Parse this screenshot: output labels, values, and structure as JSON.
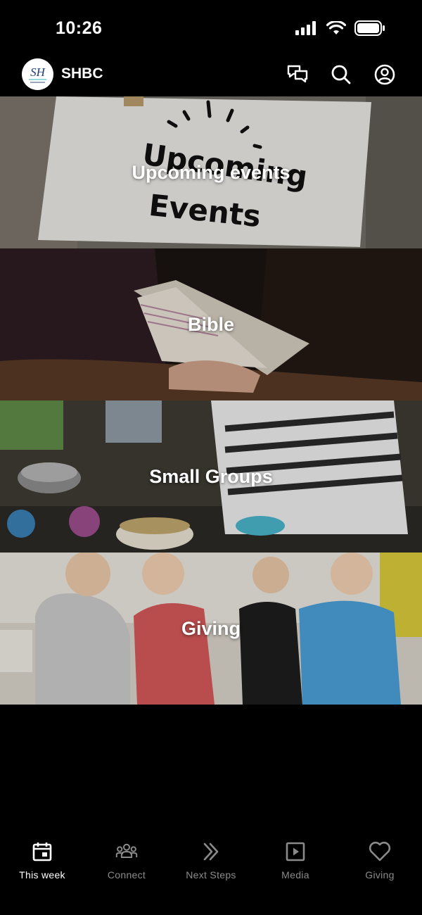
{
  "status_bar": {
    "time": "10:26"
  },
  "header": {
    "logo_text": "SH",
    "title": "SHBC"
  },
  "tiles": [
    {
      "label": "Upcoming events"
    },
    {
      "label": "Bible"
    },
    {
      "label": "Small Groups"
    },
    {
      "label": "Giving"
    }
  ],
  "tab_bar": {
    "tabs": [
      {
        "label": "This week",
        "icon": "calendar-icon",
        "active": true
      },
      {
        "label": "Connect",
        "icon": "people-icon",
        "active": false
      },
      {
        "label": "Next Steps",
        "icon": "double-chevron-right-icon",
        "active": false
      },
      {
        "label": "Media",
        "icon": "play-square-icon",
        "active": false
      },
      {
        "label": "Giving",
        "icon": "heart-icon",
        "active": false
      }
    ]
  },
  "colors": {
    "background": "#000000",
    "active_tab": "#ffffff",
    "inactive_tab": "#8a8a8a"
  }
}
